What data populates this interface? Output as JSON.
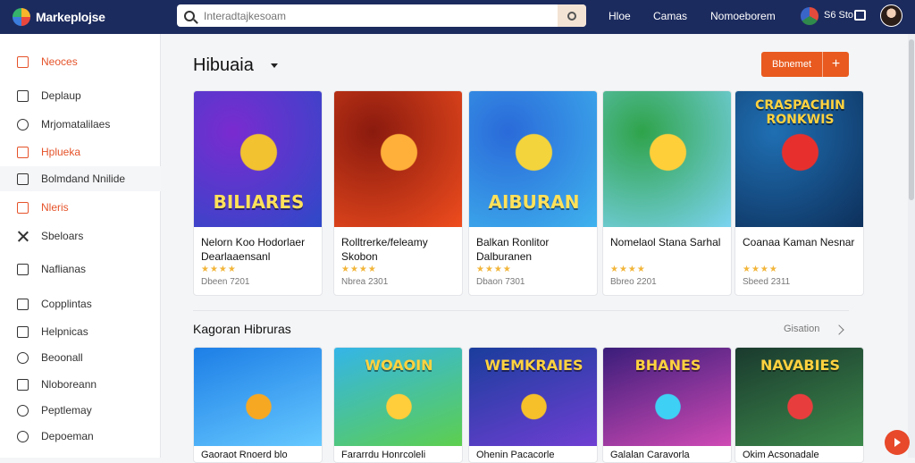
{
  "header": {
    "logo_text": "Markeplojse",
    "search_placeholder": "Interadtajkesoam",
    "nav": [
      "Hloe",
      "Camas",
      "Nomoeborem"
    ],
    "balance": "S6 Sto"
  },
  "sidebar": {
    "items": [
      {
        "label": "Neoces",
        "icon": "grid-icon",
        "active": true
      },
      {
        "label": "Deplaup",
        "icon": "doc-icon"
      },
      {
        "label": "Mrjomatalilaes",
        "icon": "circle-icon"
      },
      {
        "label": "Hplueka",
        "icon": "star-icon",
        "active": true
      },
      {
        "label": "Bolmdand Nnilide",
        "icon": "box-icon"
      },
      {
        "label": "Nleris",
        "icon": "list-icon",
        "active": true
      },
      {
        "label": "Sbeloars",
        "icon": "close-icon"
      },
      {
        "label": "Naflianas",
        "icon": "mail-icon"
      },
      {
        "label": "Copplintas",
        "icon": "check-icon"
      },
      {
        "label": "Helpnicas",
        "icon": "bell-icon"
      },
      {
        "label": "Beoonall",
        "icon": "pen-icon"
      },
      {
        "label": "Nloboreann",
        "icon": "home-icon"
      },
      {
        "label": "Peptlemay",
        "icon": "target-icon"
      },
      {
        "label": "Depoeman",
        "icon": "user-icon"
      }
    ]
  },
  "main": {
    "section_title": "Hibuaia",
    "primary_button": "Bbnemet",
    "cards": [
      {
        "title": "Nelorn Koo Hodorlaer Dearlaaensanl",
        "stars": "★★★★",
        "price": "Dbeen 7201",
        "art_text": "BILIARES",
        "colors": [
          "#2d49c8",
          "#7a2bd0",
          "#f2c230"
        ]
      },
      {
        "title": "Rolltrerke/feleamy Skobon",
        "stars": "★★★★",
        "price": "Nbrea 2301",
        "art_text": "",
        "colors": [
          "#f04d1e",
          "#8a1a0e",
          "#ffb03a"
        ]
      },
      {
        "title": "Balkan Ronlitor Dalburanen",
        "stars": "★★★★",
        "price": "Dbaon 7301",
        "art_text": "AIBURAN",
        "colors": [
          "#3fb3ee",
          "#2a6ad9",
          "#f4d43c"
        ]
      },
      {
        "title": "Nomelaol Stana Sarhal",
        "stars": "★★★★",
        "price": "Bbreo 2201",
        "art_text": "",
        "colors": [
          "#7cd4f2",
          "#2fa34a",
          "#ffcf3a"
        ]
      },
      {
        "title": "Coanaa Kaman Nesnar",
        "stars": "★★★★",
        "price": "Sbeed 2311",
        "art_text": "CRASPACHIN RONKWIS",
        "colors": [
          "#0d2f5a",
          "#1f6fb3",
          "#e7302d"
        ]
      }
    ],
    "row2_title": "Kagoran Hibruras",
    "see_all": "Gisation",
    "cards2": [
      {
        "title": "Gaoraot Rnoerd blo",
        "art_text": "",
        "colors": [
          "#1d7ee6",
          "#66c9ff",
          "#f6a823"
        ]
      },
      {
        "title": "Fararrdu Honrcoleli",
        "art_text": "WOAOIN",
        "colors": [
          "#34b5e8",
          "#5dcf4d",
          "#ffce3a"
        ]
      },
      {
        "title": "Ohenin Pacacorle",
        "art_text": "WEMKRAIES",
        "colors": [
          "#1a3d9c",
          "#6f3fd3",
          "#f5c02a"
        ]
      },
      {
        "title": "Galalan Caravorla",
        "art_text": "BHANES",
        "colors": [
          "#3a1d7a",
          "#d04ab5",
          "#3fd0f5"
        ]
      },
      {
        "title": "Okim Acsonadale",
        "art_text": "NAVABIES",
        "colors": [
          "#1a3a2e",
          "#3d8a4b",
          "#e83d3d"
        ]
      }
    ]
  }
}
